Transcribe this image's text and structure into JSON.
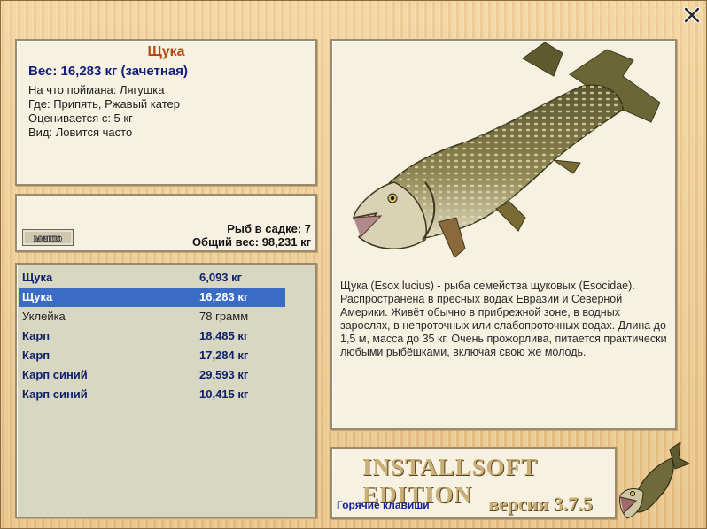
{
  "catch_info": {
    "fish_name": "Щука",
    "weight_line": "Вес: 16,283 кг (зачетная)",
    "lines": [
      "На что поймана: Лягушка",
      "Где: Припять, Ржавый катер",
      "Оценивается с: 5 кг",
      "Вид: Ловится часто"
    ]
  },
  "cage": {
    "menu_label": "меню",
    "count_text": "Рыб в садке: 7",
    "total_text": "Общий вес: 98,231 кг"
  },
  "fish_list": [
    {
      "name": "Щука",
      "weight": "6,093 кг"
    },
    {
      "name": "Щука",
      "weight": "16,283 кг"
    },
    {
      "name": "Уклейка",
      "weight": "78 грамм"
    },
    {
      "name": "Карп",
      "weight": "18,485 кг"
    },
    {
      "name": "Карп",
      "weight": "17,284 кг"
    },
    {
      "name": "Карп синий",
      "weight": "29,593 кг"
    },
    {
      "name": "Карп синий",
      "weight": "10,415 кг"
    }
  ],
  "description": "Щука (Esox lucius) - рыба семейства щуковых (Esocidae). Распространена в пресных водах Евразии и Северной Америки. Живёт обычно в прибрежной зоне, в водных зарослях, в непроточных или слабопроточных водах. Длина до 1,5 м, масса до 35 кг. Очень прожорлива, питается практически любыми рыбёшками, включая свою же молодь.",
  "brand": {
    "title": "INSTALLSOFT EDITION",
    "hotkeys_link": "Горячие клавиши",
    "version": "версия 3.7.5"
  },
  "icons": {
    "close": "close-icon",
    "fish_image": "pike-illustration",
    "logo": "pike-logo"
  },
  "colors": {
    "title": "#b4450b",
    "accent_text": "#16207a",
    "selection": "#3a6cc6"
  }
}
